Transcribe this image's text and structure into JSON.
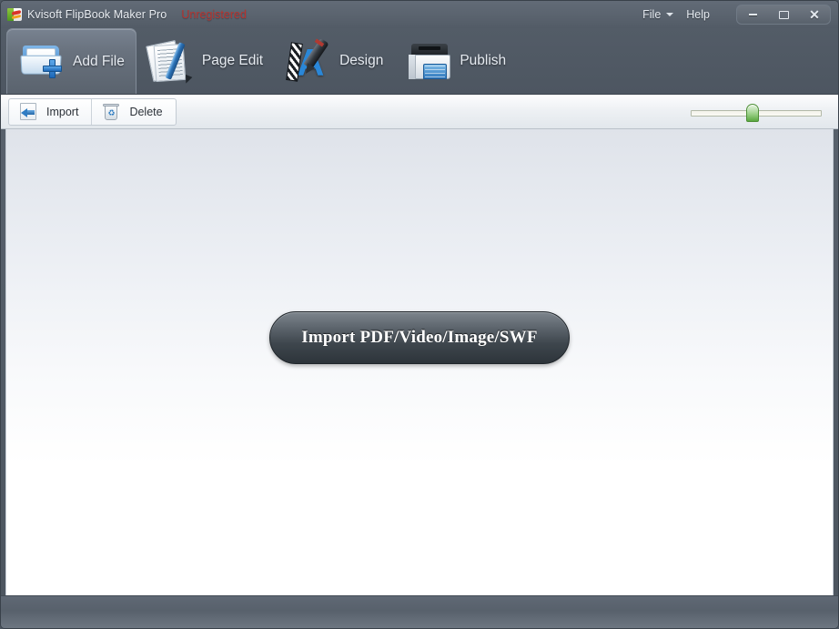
{
  "window": {
    "app_title": "Kvisoft FlipBook Maker Pro",
    "registration_status": "Unregistered",
    "logo_icon": "flipbook-logo-icon",
    "controls": {
      "minimize": "minimize-icon",
      "maximize": "maximize-icon",
      "close": "close-icon"
    }
  },
  "menubar": {
    "items": [
      {
        "label": "File",
        "has_caret": true
      },
      {
        "label": "Help",
        "has_caret": false
      }
    ]
  },
  "tabs": [
    {
      "label": "Add File",
      "icon": "folder-plus-icon",
      "active": true
    },
    {
      "label": "Page Edit",
      "icon": "pages-pen-icon",
      "active": false
    },
    {
      "label": "Design",
      "icon": "letter-a-marker-icon",
      "active": false
    },
    {
      "label": "Publish",
      "icon": "printer-icon",
      "active": false
    }
  ],
  "toolbar": {
    "buttons": [
      {
        "label": "Import",
        "icon": "import-arrow-icon"
      },
      {
        "label": "Delete",
        "icon": "trash-recycle-icon"
      }
    ],
    "zoom_slider": {
      "name": "zoom-slider",
      "value_percent": 47,
      "min": 0,
      "max": 100
    }
  },
  "main": {
    "import_button_label": "Import PDF/Video/Image/SWF"
  },
  "colors": {
    "titlebar": "#5a636e",
    "unregistered_text": "#b7332f",
    "accent_blue": "#2f7cc4",
    "slider_thumb_green": "#5aa83f",
    "content_background": "#ffffff"
  }
}
